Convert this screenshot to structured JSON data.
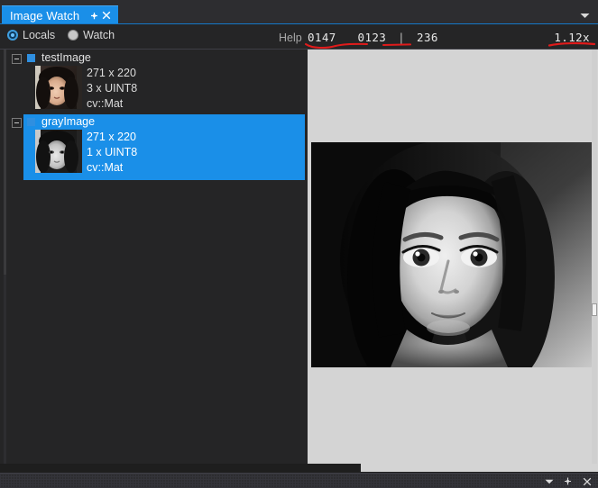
{
  "window": {
    "tab_title": "Image Watch",
    "pin_icon": "pin-icon",
    "close_icon": "close-icon",
    "tab_overflow_icon": "chevron-down-icon"
  },
  "toolstrip": {
    "modes": [
      {
        "label": "Locals",
        "selected": true
      },
      {
        "label": "Watch",
        "selected": false
      }
    ],
    "help_label": "Help",
    "cursor_x": "0147",
    "cursor_y": "0123",
    "separator": "|",
    "pixel_value": "236",
    "zoom_level": "1.12x",
    "annotation_color": "#e01b1b"
  },
  "tree": {
    "nodes": [
      {
        "name": "testImage",
        "dimensions": "271 x 220",
        "channels_type": "3 x UINT8",
        "cpp_type": "cv::Mat",
        "selected": false,
        "expander": "collapse-box",
        "thumbnail": "color-portrait-thumbnail"
      },
      {
        "name": "grayImage",
        "dimensions": "271 x 220",
        "channels_type": "1 x UINT8",
        "cpp_type": "cv::Mat",
        "selected": true,
        "expander": "collapse-box",
        "thumbnail": "grayscale-portrait-thumbnail"
      }
    ],
    "selection_color": "#1a8fe8"
  },
  "viewer": {
    "background_color": "#d4d4d4",
    "image_name": "grayscale-portrait-image"
  },
  "statusbar": {
    "dropdown_icon": "chevron-down-icon",
    "pin_icon": "pin-icon",
    "close_icon": "close-icon"
  }
}
